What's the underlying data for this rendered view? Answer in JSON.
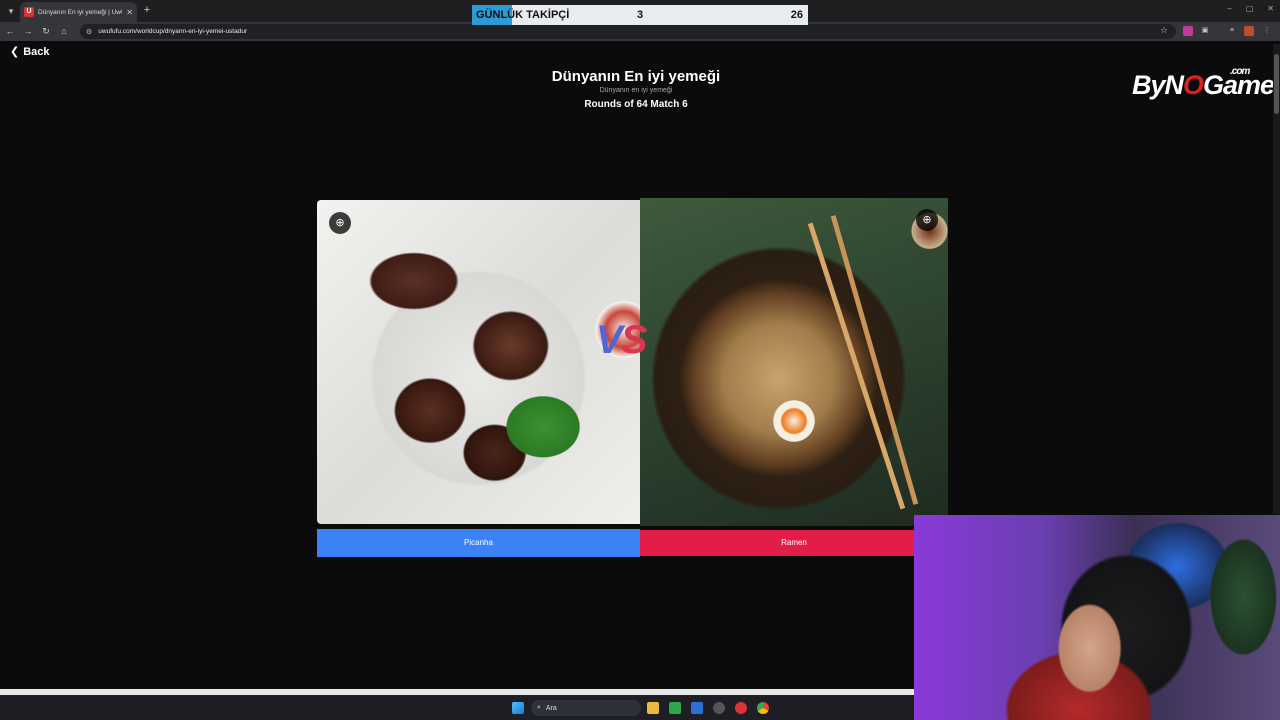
{
  "browser": {
    "tab_title": "Dünyanın En iyi yemeği | UwU...",
    "tab_favicon": "U",
    "url": "uwufufu.com/worldcup/dnyann-en-iyi-yemei-ustadur",
    "win_minimize": "–",
    "win_maximize": "▢",
    "win_close": "✕"
  },
  "counter": {
    "label": "GÜNLÜK TAKİPÇİ",
    "current": "3",
    "target": "26",
    "accent": "#2f9bd4"
  },
  "page": {
    "back_label": "Back",
    "title": "Dünyanın En iyi yemeği",
    "subtitle": "Dünyanın en iyi yemeği",
    "round_info": "Rounds of 64 Match 6",
    "vs_v": "V",
    "vs_s": "S"
  },
  "logo": {
    "text_by": "By",
    "text_n": "N",
    "text_slash": "O",
    "text_game": "Game",
    "dotcom": ".com"
  },
  "choices": [
    {
      "label": "Picanha",
      "color": "#3b82f6",
      "image": "picanha-photo"
    },
    {
      "label": "Ramen",
      "color": "#e11d48",
      "image": "ramen-photo"
    }
  ],
  "taskbar": {
    "search_placeholder": "Ara"
  },
  "icons": [
    "back-chevron-icon",
    "zoom-in-icon",
    "star-icon",
    "reload-icon",
    "home-icon",
    "search-icon",
    "windows-start-icon"
  ]
}
